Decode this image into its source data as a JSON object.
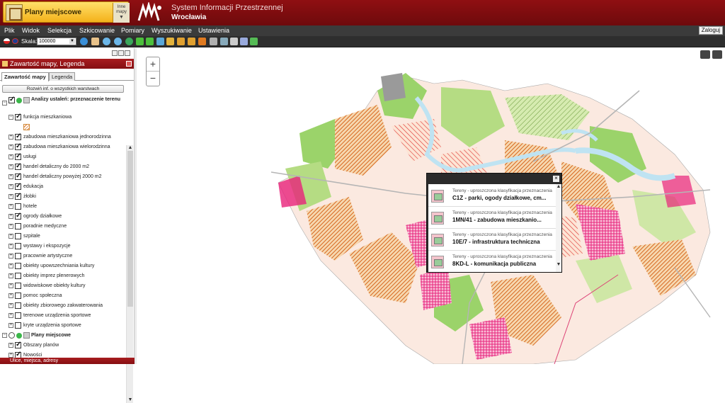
{
  "header": {
    "mapset_title": "Plany miejscowe",
    "mapset_switch_label": "Inne mapy",
    "system_title": "System Informacji Przestrzennej",
    "system_subtitle": "Wrocławia"
  },
  "menu": {
    "items": [
      "Plik",
      "Widok",
      "Selekcja",
      "Szkicowanie",
      "Pomiary",
      "Wyszukiwanie",
      "Ustawienia"
    ],
    "login_label": "Zaloguj"
  },
  "toolbar": {
    "scale_label": "Skala:",
    "scale_value": "100000",
    "tool_icons": [
      "info-icon",
      "pan-hand-icon",
      "zoom-in-icon",
      "zoom-out-icon",
      "globe-icon",
      "back-arrow-icon",
      "forward-arrow-icon",
      "full-extent-icon",
      "pencil-icon",
      "measure-line-icon",
      "measure-angle-icon",
      "crop-icon",
      "layers-icon",
      "print-preview-icon",
      "print-icon",
      "link-icon",
      "export-icon"
    ]
  },
  "left_panel": {
    "title": "Zawartość mapy, Legenda",
    "tabs": [
      "Zawartość mapy",
      "Legenda"
    ],
    "expand_all_label": "Rozwiń inf. o wszystkich warstwach",
    "group1_label": "Analizy ustaleń: przeznaczenie terenu",
    "layers": [
      {
        "label": "funkcja mieszkaniowa",
        "checked": true
      },
      {
        "label": "zabudowa mieszkaniowa jednorodzinna",
        "checked": true
      },
      {
        "label": "zabudowa mieszkaniowa wielorodzinna",
        "checked": true
      },
      {
        "label": "usługi",
        "checked": true
      },
      {
        "label": "handel detaliczny do 2000 m2",
        "checked": true
      },
      {
        "label": "handel detaliczny powyżej 2000 m2",
        "checked": true
      },
      {
        "label": "edukacja",
        "checked": true
      },
      {
        "label": "żłobki",
        "checked": true
      },
      {
        "label": "hotele",
        "checked": false
      },
      {
        "label": "ogrody działkowe",
        "checked": true
      },
      {
        "label": "poradnie medyczne",
        "checked": false
      },
      {
        "label": "szpitale",
        "checked": false
      },
      {
        "label": "wystawy i ekspozycje",
        "checked": false
      },
      {
        "label": "pracownie artystyczne",
        "checked": false
      },
      {
        "label": "obiekty upowszechniania kultury",
        "checked": false
      },
      {
        "label": "obiekty imprez plenerowych",
        "checked": false
      },
      {
        "label": "widowiskowe obiekty kultury",
        "checked": false
      },
      {
        "label": "pomoc społeczna",
        "checked": false
      },
      {
        "label": "obiekty zbiorowego zakwaterowania",
        "checked": false
      },
      {
        "label": "terenowe urządzenia sportowe",
        "checked": false
      },
      {
        "label": "kryte urządzenia sportowe",
        "checked": false
      }
    ],
    "group2_label": "Plany miejscowe",
    "group2_layers": [
      {
        "label": "Obszary planów",
        "checked": true
      },
      {
        "label": "Nowości",
        "checked": true
      }
    ],
    "bottom_panel_title": "Ulice, miejsca, adresy"
  },
  "map": {
    "zoom_in": "+",
    "zoom_out": "−"
  },
  "popup": {
    "items": [
      {
        "subtitle": "Tereny - uproszczona klasyfikacja przeznaczenia",
        "title": "C1Z - parki, ogody działkowe, cm..."
      },
      {
        "subtitle": "Tereny - uproszczona klasyfikacja przeznaczenia",
        "title": "1MN/41 - zabudowa mieszkanio..."
      },
      {
        "subtitle": "Tereny - uproszczona klasyfikacja przeznaczenia",
        "title": "10E/7 - infrastruktura techniczna"
      },
      {
        "subtitle": "Tereny - uproszczona klasyfikacja przeznaczenia",
        "title": "8KD-L - komunikacja publiczna"
      }
    ],
    "close": "×"
  },
  "colors": {
    "header_red": "#8f0f12",
    "residential_orange": "#e0782a",
    "green_space": "#9bd36a",
    "services_pink": "#e8227a",
    "water_blue": "#bfe3f2"
  }
}
